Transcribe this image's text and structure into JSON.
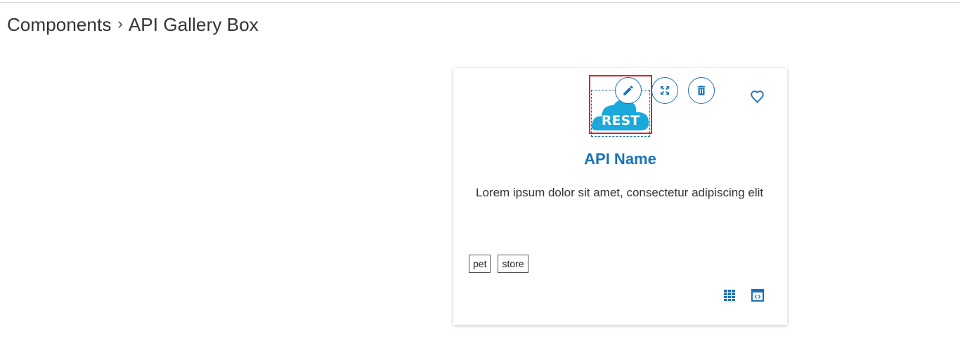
{
  "breadcrumb": {
    "parent": "Components",
    "separator": "›",
    "current": "API Gallery Box"
  },
  "card": {
    "logo_text": "REST",
    "api_name": "API Name",
    "description": "Lorem ipsum dolor sit amet, consectetur adipiscing elit",
    "tags": [
      "pet",
      "store"
    ],
    "icons": {
      "edit": "pencil-icon",
      "expand": "expand-icon",
      "delete": "trash-icon",
      "favorite": "heart-outline-icon",
      "table": "table-icon",
      "code": "code-window-icon"
    }
  },
  "colors": {
    "accent": "#1a73b8",
    "selection": "#d9242c",
    "cloud": "#1ba9dc"
  }
}
